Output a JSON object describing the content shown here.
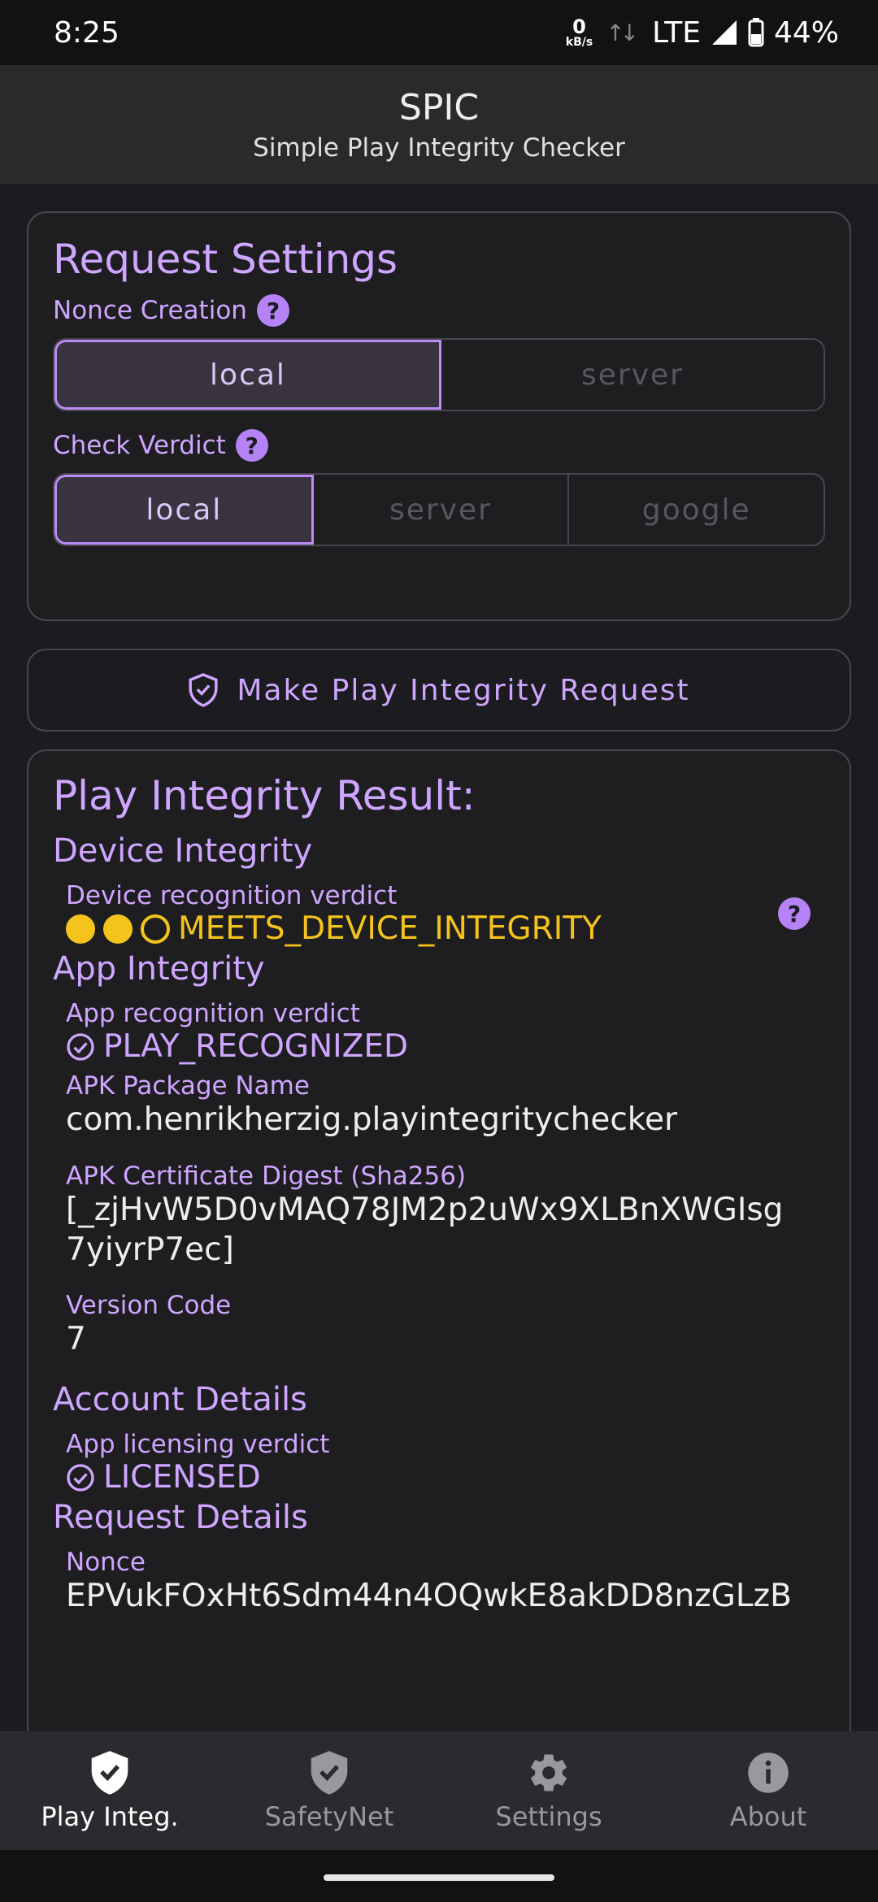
{
  "status_bar": {
    "time": "8:25",
    "net_speed_value": "0",
    "net_speed_unit": "kB/s",
    "network": "LTE",
    "battery": "44%"
  },
  "app_bar": {
    "title": "SPIC",
    "subtitle": "Simple Play Integrity Checker"
  },
  "request_settings": {
    "title": "Request Settings",
    "nonce_label": "Nonce Creation",
    "nonce_options": [
      "local",
      "server"
    ],
    "nonce_selected": "local",
    "verdict_label": "Check Verdict",
    "verdict_options": [
      "local",
      "server",
      "google"
    ],
    "verdict_selected": "local",
    "help_symbol": "?"
  },
  "request_button": {
    "label": "Make Play Integrity Request",
    "icon": "shield-check-icon"
  },
  "result": {
    "title": "Play Integrity Result:",
    "device_integrity": {
      "title": "Device Integrity",
      "label": "Device recognition verdict",
      "value": "MEETS_DEVICE_INTEGRITY",
      "dots_filled": 2,
      "dots_total": 3,
      "color": "#f4c41c"
    },
    "app_integrity": {
      "title": "App Integrity",
      "recognition_label": "App recognition verdict",
      "recognition_value": "PLAY_RECOGNIZED",
      "package_label": "APK Package Name",
      "package_value": "com.henrikherzig.playintegritychecker",
      "digest_label": "APK Certificate Digest (Sha256)",
      "digest_value_line1": "[_zjHvW5D0vMAQ78JM2p2uWx9XLBnXWGIsg",
      "digest_value_line2": "7yiyrP7ec]",
      "version_label": "Version Code",
      "version_value": "7"
    },
    "account_details": {
      "title": "Account Details",
      "licensing_label": "App licensing verdict",
      "licensing_value": "LICENSED"
    },
    "request_details": {
      "title": "Request Details",
      "nonce_label": "Nonce",
      "nonce_value": "EPVukFOxHt6Sdm44n4OQwkE8akDD8nzGLzB"
    }
  },
  "bottom_nav": {
    "items": [
      {
        "label": "Play Integ.",
        "icon": "shield-check-icon",
        "active": true
      },
      {
        "label": "SafetyNet",
        "icon": "shield-check-icon",
        "active": false
      },
      {
        "label": "Settings",
        "icon": "gear-icon",
        "active": false
      },
      {
        "label": "About",
        "icon": "info-icon",
        "active": false
      }
    ]
  },
  "colors": {
    "accent": "#cfa6ff",
    "warning": "#f4c41c",
    "background": "#1c1b1f"
  }
}
